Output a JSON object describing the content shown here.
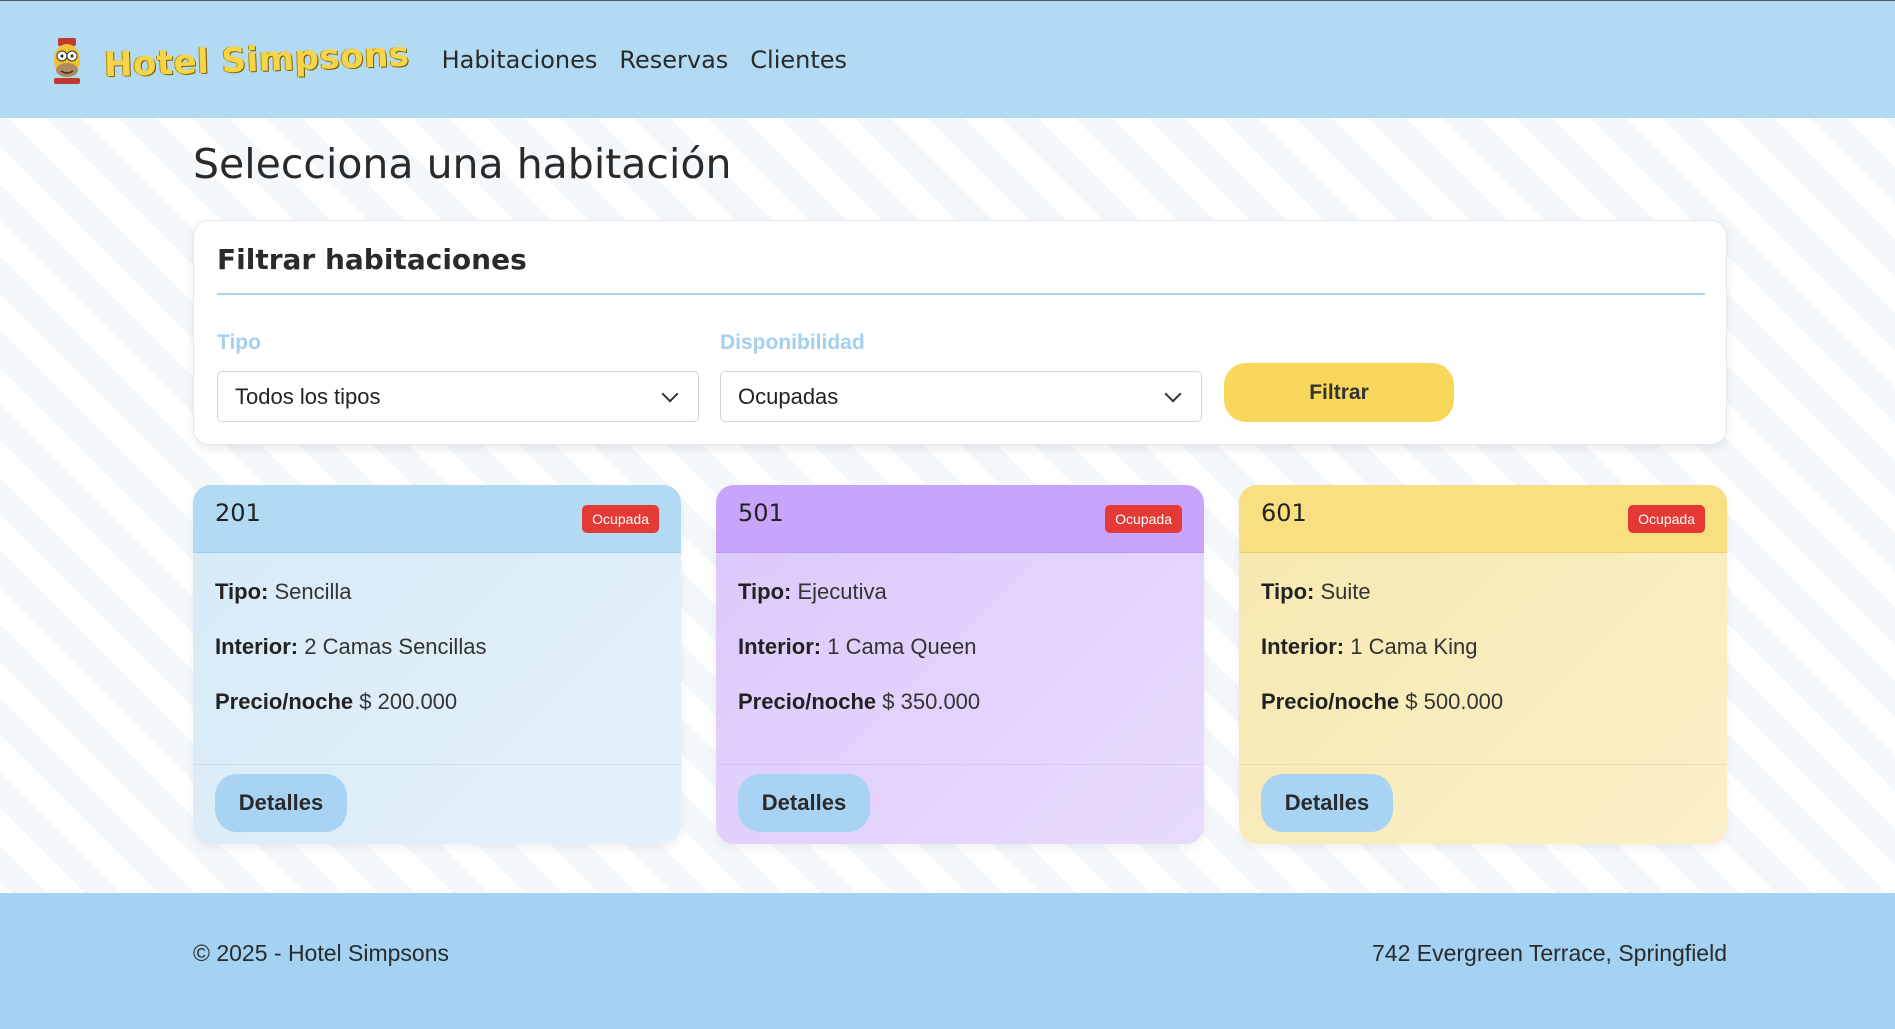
{
  "navbar": {
    "brand": "Hotel Simpsons",
    "links": [
      "Habitaciones",
      "Reservas",
      "Clientes"
    ]
  },
  "page": {
    "title": "Selecciona una habitación"
  },
  "filter": {
    "title": "Filtrar habitaciones",
    "type_label": "Tipo",
    "type_value": "Todos los tipos",
    "availability_label": "Disponibilidad",
    "availability_value": "Ocupadas",
    "button_label": "Filtrar"
  },
  "labels": {
    "tipo": "Tipo:",
    "interior": "Interior:",
    "precio": "Precio/noche"
  },
  "rooms": [
    {
      "number": "201",
      "status": "Ocupada",
      "type": "Sencilla",
      "interior": "2 Camas Sencillas",
      "price": "$ 200.000",
      "button": "Detalles",
      "color": "#b2daf3"
    },
    {
      "number": "501",
      "status": "Ocupada",
      "type": "Ejecutiva",
      "interior": "1 Cama Queen",
      "price": "$ 350.000",
      "button": "Detalles",
      "color": "#c8a5fb"
    },
    {
      "number": "601",
      "status": "Ocupada",
      "type": "Suite",
      "interior": "1 Cama King",
      "price": "$ 500.000",
      "button": "Detalles",
      "color": "#f8df80"
    }
  ],
  "footer": {
    "left": "© 2025 - Hotel Simpsons",
    "right": "742 Evergreen Terrace, Springfield"
  },
  "colors": {
    "navbar": "#b2daf3",
    "badge": "#e53935",
    "filter_button": "#f8d75a",
    "details_button": "#a9d3f2",
    "footer": "#a3d2f2"
  }
}
